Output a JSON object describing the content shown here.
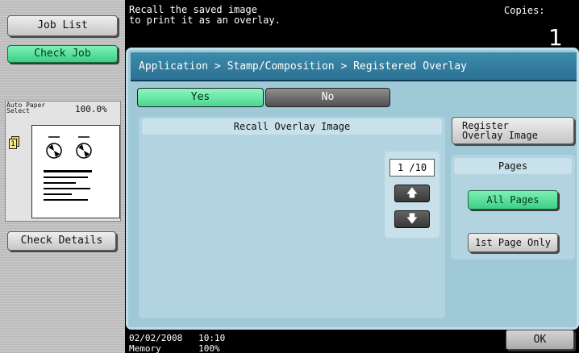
{
  "sidebar": {
    "job_list_label": "Job List",
    "check_job_label": "Check Job",
    "preview": {
      "paper_select_label": "Auto Paper\nSelect",
      "zoom": "100.0%",
      "page_badge": "1"
    },
    "check_details_label": "Check Details"
  },
  "header": {
    "message": "Recall the saved image\nto print it as an overlay.",
    "copies_label": "Copies:",
    "copies_value": "1"
  },
  "main": {
    "breadcrumb": "Application > Stamp/Composition > Registered Overlay",
    "yes_label": "Yes",
    "no_label": "No",
    "list_title": "Recall Overlay Image",
    "page_indicator": "1 /10",
    "up_icon": "arrow-up-icon",
    "down_icon": "arrow-down-icon",
    "register_label": "Register\nOverlay Image",
    "pages_title": "Pages",
    "all_pages_label": "All Pages",
    "first_page_label": "1st Page Only"
  },
  "footer": {
    "datetime": "02/02/2008   10:10",
    "memory": "Memory       100%",
    "ok_label": "OK"
  },
  "colors": {
    "accent_green": "#4fdb93",
    "panel_blue": "#9fc9d7",
    "breadcrumb_blue": "#2f7a9c"
  }
}
